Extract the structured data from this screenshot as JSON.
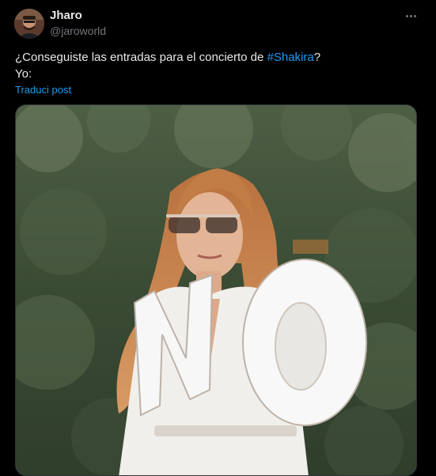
{
  "post": {
    "author_name": "Jharo",
    "author_handle": "@jaroworld",
    "text_before": "¿Conseguiste las entradas para el concierto de ",
    "hashtag": "#Shakira",
    "text_after": "?",
    "line2": "Yo:",
    "translate_label": "Traduci post"
  },
  "colors": {
    "background": "#000000",
    "text": "#e7e9ea",
    "secondary": "#71767b",
    "link": "#1d9bf0"
  },
  "icons": {
    "more": "more-horizontal-icon"
  }
}
